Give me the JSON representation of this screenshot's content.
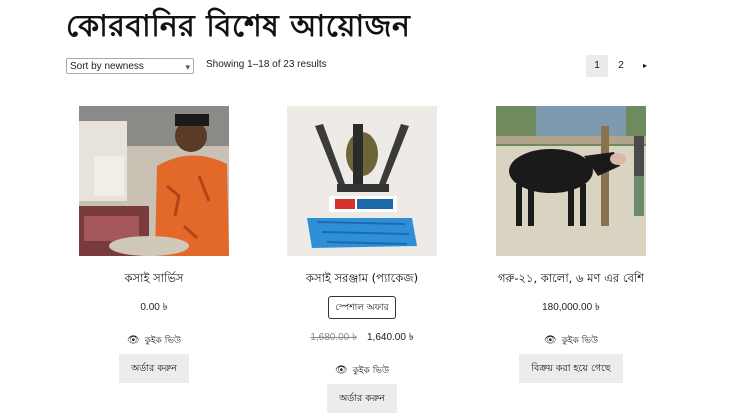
{
  "page": {
    "title": "কোরবানির বিশেষ আয়োজন"
  },
  "toolbar": {
    "sort_selected": "Sort by newness",
    "result_count": "Showing 1–18 of 23 results"
  },
  "pagination": {
    "pages": [
      "1",
      "2"
    ],
    "current": "1",
    "next_icon": "▸"
  },
  "products": [
    {
      "name": "কসাই সার্ভিস",
      "price": "0.00 ৳",
      "quick_view": "কুইক ভিউ",
      "button": "অর্ডার করুন"
    },
    {
      "name": "কসাই সরঞ্জাম (প্যাকেজ)",
      "badge": "স্পেশাল অফার",
      "old_price": "1,680.00 ৳",
      "price": "1,640.00 ৳",
      "quick_view": "কুইক ভিউ",
      "button": "অর্ডার করুন"
    },
    {
      "name": "গরু-২১, কালো, ৬ মণ এর বেশি",
      "price": "180,000.00 ৳",
      "quick_view": "কুইক ভিউ",
      "button": "বিক্রয় করা হয়ে গেছে"
    }
  ],
  "icons": {
    "eye": "👁",
    "chevron": "▾"
  }
}
